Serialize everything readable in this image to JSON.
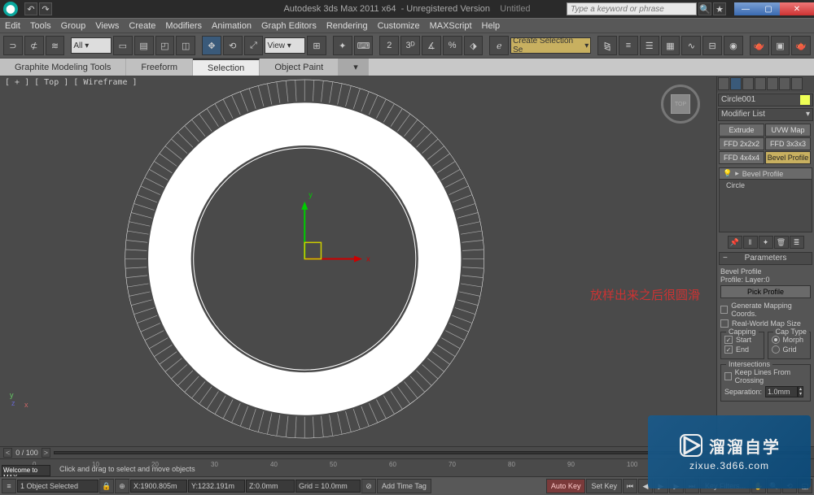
{
  "titlebar": {
    "app": "Autodesk 3ds Max  2011 x64",
    "reg": "- Unregistered Version",
    "doc": "Untitled",
    "search_ph": "Type a keyword or phrase"
  },
  "menu": [
    "Edit",
    "Tools",
    "Group",
    "Views",
    "Create",
    "Modifiers",
    "Animation",
    "Graph Editors",
    "Rendering",
    "Customize",
    "MAXScript",
    "Help"
  ],
  "toolbar": {
    "set_all": "All",
    "view_dd": "View",
    "sel_set": "Create Selection Se"
  },
  "ribbon": [
    "Graphite Modeling Tools",
    "Freeform",
    "Selection",
    "Object Paint"
  ],
  "viewport": {
    "label": "[ + ] [ Top ] [ Wireframe ]",
    "cube": "TOP",
    "annotation": "放样出来之后很圆滑",
    "axes": {
      "x": "x",
      "y": "y",
      "z": "z"
    }
  },
  "panel": {
    "object_name": "Circle001",
    "mod_list_ph": "Modifier List",
    "mod_btns": [
      "Extrude",
      "UVW Map",
      "FFD 2x2x2",
      "FFD 3x3x3",
      "FFD 4x4x4",
      "Bevel Profile"
    ],
    "stack": {
      "mod": "Bevel Profile",
      "base": "Circle"
    },
    "rollout_params": "Parameters",
    "bevel_profile_title": "Bevel Profile",
    "profile_label": "Profile: Layer:0",
    "pick_profile": "Pick Profile",
    "gen_map": "Generate Mapping Coords.",
    "real_world": "Real-World Map Size",
    "capping_title": "Capping",
    "cap_start": "Start",
    "cap_end": "End",
    "cap_type_title": "Cap Type",
    "morph": "Morph",
    "grid": "Grid",
    "intersections_title": "Intersections",
    "keep_lines": "Keep Lines From Crossing",
    "separation": "Separation:",
    "sep_val": "1.0mm"
  },
  "timeline": {
    "frame": "0 / 100",
    "ticks": [
      0,
      10,
      20,
      30,
      40,
      50,
      60,
      70,
      80,
      90,
      100
    ],
    "welcome": "Welcome to MAX"
  },
  "status": {
    "selected": "1 Object Selected",
    "hint": "Click and drag to select and move objects",
    "x": "1900.805m",
    "y": "1232.191m",
    "z": "0.0mm",
    "grid": "Grid = 10.0mm",
    "add_tag": "Add Time Tag",
    "auto_key": "Auto Key",
    "set_key": "Set Key",
    "key_filters": "Key Filters..."
  },
  "watermark": {
    "zh": "溜溜自学",
    "url": "zixue.3d66.com"
  }
}
